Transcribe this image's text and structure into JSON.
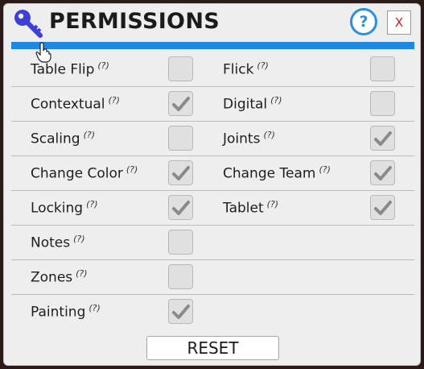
{
  "header": {
    "title": "PERMISSIONS",
    "help_label": "?",
    "close_label": "X",
    "key_icon": "key-icon"
  },
  "colors": {
    "accent": "#1d88e5",
    "key": "#3d3fd6",
    "close": "#d22020",
    "panel": "#eeeeee"
  },
  "hint_text": "(?)",
  "permissions": [
    {
      "left": {
        "label": "Table Flip",
        "checked": false
      },
      "right": {
        "label": "Flick",
        "checked": false
      }
    },
    {
      "left": {
        "label": "Contextual",
        "checked": true
      },
      "right": {
        "label": "Digital",
        "checked": false
      }
    },
    {
      "left": {
        "label": "Scaling",
        "checked": false
      },
      "right": {
        "label": "Joints",
        "checked": true
      }
    },
    {
      "left": {
        "label": "Change Color",
        "checked": true
      },
      "right": {
        "label": "Change Team",
        "checked": true
      }
    },
    {
      "left": {
        "label": "Locking",
        "checked": true
      },
      "right": {
        "label": "Tablet",
        "checked": true
      }
    },
    {
      "left": {
        "label": "Notes",
        "checked": false
      },
      "right": null
    },
    {
      "left": {
        "label": "Zones",
        "checked": false
      },
      "right": null
    },
    {
      "left": {
        "label": "Painting",
        "checked": true
      },
      "right": null
    }
  ],
  "footer": {
    "reset_label": "RESET"
  }
}
